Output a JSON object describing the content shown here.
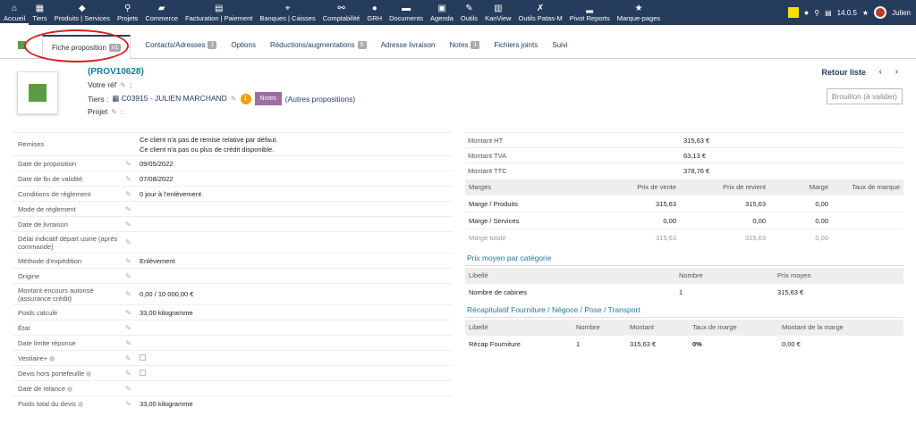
{
  "topnav": {
    "items": [
      {
        "label": "Accueil",
        "icon": "home-icon",
        "glyph": "⌂"
      },
      {
        "label": "Tiers",
        "icon": "building-icon",
        "glyph": "▦"
      },
      {
        "label": "Produits | Services",
        "icon": "cube-icon",
        "glyph": "◆"
      },
      {
        "label": "Projets",
        "icon": "sitemap-icon",
        "glyph": "⚲"
      },
      {
        "label": "Commerce",
        "icon": "briefcase-icon",
        "glyph": "▰"
      },
      {
        "label": "Facturation | Paiement",
        "icon": "money-icon",
        "glyph": "▤"
      },
      {
        "label": "Banques | Caisses",
        "icon": "bank-icon",
        "glyph": "⌖"
      },
      {
        "label": "Comptabilité",
        "icon": "search-dollar-icon",
        "glyph": "⚯"
      },
      {
        "label": "GRH",
        "icon": "user-tie-icon",
        "glyph": "●"
      },
      {
        "label": "Documents",
        "icon": "folder-icon",
        "glyph": "▬"
      },
      {
        "label": "Agenda",
        "icon": "calendar-icon",
        "glyph": "▣"
      },
      {
        "label": "Outils",
        "icon": "wrench-icon",
        "glyph": "✎"
      },
      {
        "label": "KanView",
        "icon": "kanban-icon",
        "glyph": "▥"
      },
      {
        "label": "Outils Patas-M",
        "icon": "tools-icon",
        "glyph": "✗"
      },
      {
        "label": "Pivot Reports",
        "icon": "chart-icon",
        "glyph": "▂"
      },
      {
        "label": "Marque-pages",
        "icon": "star-icon",
        "glyph": "★"
      }
    ],
    "version": "14.0.5",
    "user": "Julien"
  },
  "tabs": [
    {
      "label": "Fiche proposition",
      "badge": "v1",
      "active": true
    },
    {
      "label": "Contacts/Adresses",
      "badge": "1"
    },
    {
      "label": "Options",
      "badge": ""
    },
    {
      "label": "Réductions/augmentations",
      "badge": "0"
    },
    {
      "label": "Adresse livraison",
      "badge": ""
    },
    {
      "label": "Notes",
      "badge": "1"
    },
    {
      "label": "Fichiers joints",
      "badge": ""
    },
    {
      "label": "Suivi",
      "badge": ""
    }
  ],
  "header": {
    "ref": "(PROV10628)",
    "votre_ref": "Votre réf",
    "tiers_label": "Tiers :",
    "tiers_value": "C03915 - JULIEN MARCHAND",
    "count": "1",
    "notes_btn": "Notes",
    "autres": "(Autres propositions)",
    "projet": "Projet",
    "back_list": "Retour liste",
    "prev": "‹",
    "next": "›",
    "draft": "Brouillon (à valider)"
  },
  "left": {
    "remises_label": "Remises",
    "remises_line1": "Ce client n'a pas de remise relative par défaut.",
    "remises_line2": "Ce client n'a pas ou plus de crédit disponible.",
    "rows": [
      {
        "label": "Date de proposition",
        "value": "09/05/2022"
      },
      {
        "label": "Date de fin de validité",
        "value": "07/08/2022"
      },
      {
        "label": "Conditions de règlement",
        "value": "0 jour à l'enlèvement"
      },
      {
        "label": "Mode de règlement",
        "value": ""
      },
      {
        "label": "Date de livraison",
        "value": ""
      },
      {
        "label": "Délai indicatif départ usine (après commande)",
        "value": ""
      },
      {
        "label": "Méthode d'expédition",
        "value": "Enlèvement"
      },
      {
        "label": "Origine",
        "value": ""
      },
      {
        "label": "Montant encours autorisé (assurance crédit)",
        "value": "0,00 / 10 000,00 €"
      },
      {
        "label": "Poids calculé",
        "value": "33,00 kilogramme"
      },
      {
        "label": "État",
        "value": ""
      },
      {
        "label": "Date limite réponse",
        "value": ""
      },
      {
        "label": "Vestiaire+",
        "value": "",
        "info": true,
        "checkbox": true
      },
      {
        "label": "Devis hors portefeuille",
        "value": "",
        "info": true,
        "checkbox": true
      },
      {
        "label": "Date de relance",
        "value": "",
        "info": true
      },
      {
        "label": "Poids total du devis",
        "value": "33,00 kilogramme",
        "info": true
      }
    ]
  },
  "amounts": [
    {
      "label": "Montant HT",
      "value": "315,63 €"
    },
    {
      "label": "Montant TVA",
      "value": "63,13 €"
    },
    {
      "label": "Montant TTC",
      "value": "378,76 €"
    }
  ],
  "margins": {
    "headers": [
      "Marges",
      "Prix de vente",
      "Prix de revient",
      "Marge",
      "Taux de marque"
    ],
    "rows": [
      [
        "Marge / Produits",
        "315,63",
        "315,63",
        "0,00",
        ""
      ],
      [
        "Marge / Services",
        "0,00",
        "0,00",
        "0,00",
        ""
      ],
      [
        "Marge totale",
        "315,63",
        "315,63",
        "0,00",
        ""
      ]
    ]
  },
  "prix_moyen": {
    "title": "Prix moyen par catégorie",
    "headers": [
      "Libellé",
      "Nombre",
      "Prix moyen"
    ],
    "rows": [
      [
        "Nombre de cabines",
        "1",
        "315,63 €"
      ]
    ]
  },
  "recap": {
    "title": "Récapitulatif Fourniture / Négoce / Pose / Transport",
    "headers": [
      "Libellé",
      "Nombre",
      "Montant",
      "Taux de marge",
      "Montant de la marge"
    ],
    "rows": [
      [
        "Récap Fourniture",
        "1",
        "315,63 €",
        "0%",
        "0,00 €"
      ]
    ]
  }
}
